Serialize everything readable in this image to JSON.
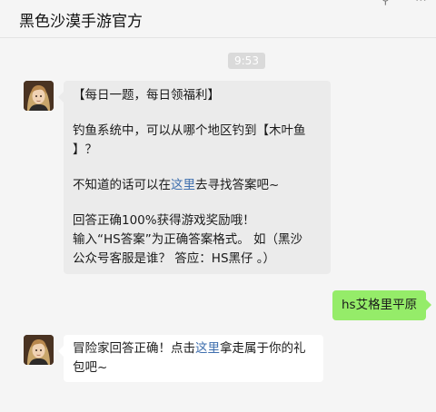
{
  "header": {
    "title": "黑色沙漠手游官方",
    "icons": [
      "pin-icon",
      "more-icon"
    ]
  },
  "timestamp": "9:53",
  "messages": {
    "m1": {
      "line1": "【每日一题，每日领福利】",
      "line2a": "钓鱼系统中，可以从哪个地区钓到【木叶鱼",
      "line2b": "】？",
      "line3_pre": "不知道的话可以在",
      "line3_link": "这里",
      "line3_post": "去寻找答案吧~",
      "line4": "回答正确100%获得游戏奖励哦！",
      "line5": "输入“HS答案”为正确答案格式。 如（黑沙",
      "line6": "公众号客服是谁？ 答应：HS黑仔 。）"
    },
    "m2": {
      "text": "hs艾格里平原"
    },
    "m3": {
      "text_pre": "冒险家回答正确！点击",
      "link": "这里",
      "text_post1": "拿走属于你的礼",
      "text_post2": "包吧~"
    }
  }
}
